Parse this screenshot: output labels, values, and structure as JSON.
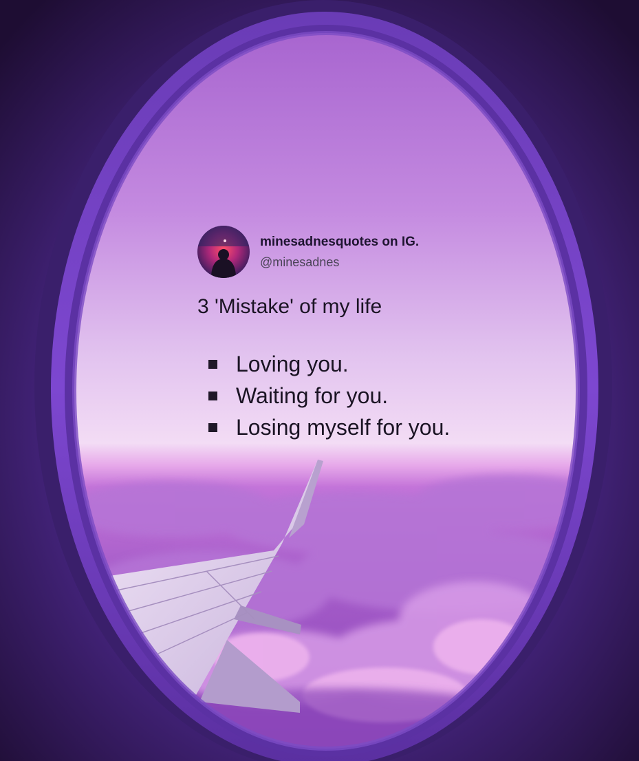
{
  "post": {
    "display_name": "minesadnesquotes on IG.",
    "handle": "@minesadnes",
    "title": "3 'Mistake' of my life",
    "items": [
      "Loving you.",
      "Waiting for you.",
      "Losing myself for you."
    ]
  },
  "colors": {
    "frame": "#4a2a86",
    "sky_top": "#b16fd6",
    "sky_horizon": "#f1d6f3",
    "clouds": "#9d56c6",
    "text": "#1b1424"
  },
  "icons": [
    "crescent-moon-icon",
    "avatar-silhouette-icon",
    "square-bullet-icon"
  ]
}
